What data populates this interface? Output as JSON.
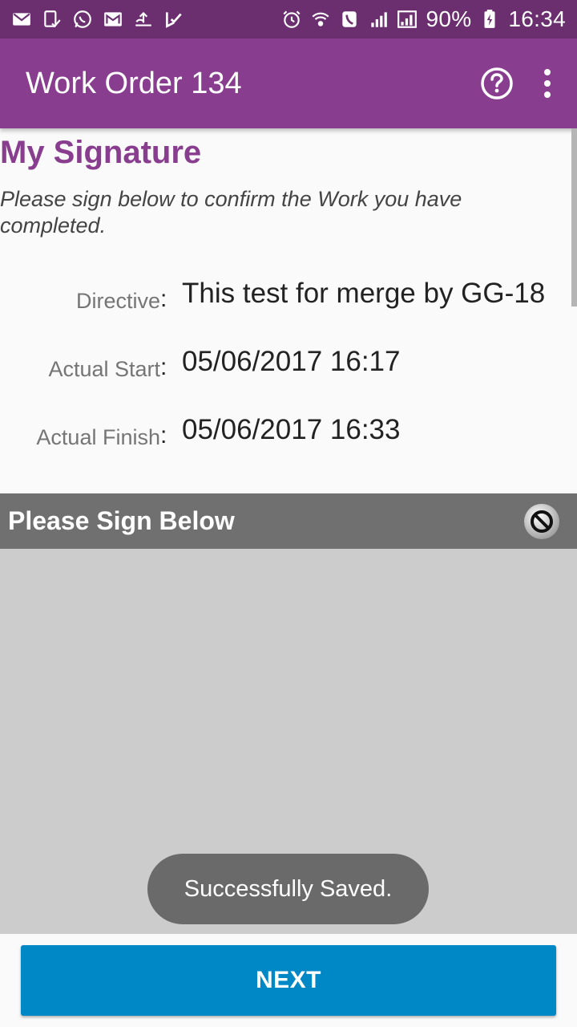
{
  "status_bar": {
    "left_icons": [
      "mail-icon",
      "voicemail-icon",
      "whatsapp-icon",
      "gmail-icon",
      "upload-icon",
      "check-icon"
    ],
    "right_icons": [
      "alarm-icon",
      "wifi-calling-icon",
      "phone-icon",
      "signal-icon",
      "signal-2-icon"
    ],
    "battery": "90%",
    "time": "16:34"
  },
  "app_bar": {
    "title": "Work Order 134",
    "actions": [
      "help-icon",
      "more-vert-icon"
    ]
  },
  "content": {
    "heading": "My Signature",
    "instruction": "Please sign below to confirm the Work you have completed.",
    "fields": [
      {
        "label": "Directive",
        "value": "This test for merge by GG-18"
      },
      {
        "label": "Actual Start",
        "value": "05/06/2017 16:17"
      },
      {
        "label": "Actual Finish",
        "value": "05/06/2017 16:33"
      }
    ],
    "colon": ":"
  },
  "signature": {
    "header": "Please Sign Below",
    "clear_icon": "block-icon"
  },
  "toast": "Successfully Saved.",
  "next_button": "NEXT",
  "colors": {
    "status_bar": "#6b2f70",
    "app_bar": "#883d8e",
    "accent": "#883d8e",
    "button": "#0088c6",
    "sign_header": "#707070",
    "sign_pad": "#cccccc"
  }
}
